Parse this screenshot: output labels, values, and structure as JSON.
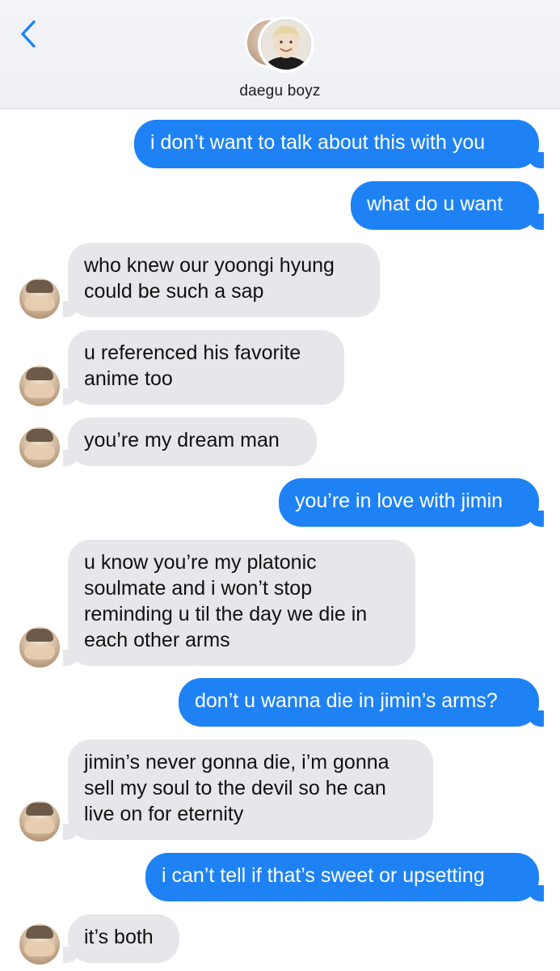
{
  "header": {
    "title": "daegu boyz",
    "back_icon": "chevron-left-icon",
    "accent": "#1e82f5"
  },
  "colors": {
    "sent_bubble": "#1e82f5",
    "received_bubble": "#e6e6eb",
    "sent_text": "#ffffff",
    "received_text": "#111111"
  },
  "messages": [
    {
      "direction": "sent",
      "text": "i don’t want to talk about this with you"
    },
    {
      "direction": "sent",
      "text": "what do u want"
    },
    {
      "direction": "received",
      "text": "who knew our yoongi hyung\ncould be such a sap"
    },
    {
      "direction": "received",
      "text": "u referenced his favorite\nanime too"
    },
    {
      "direction": "received",
      "text": "you’re my dream man"
    },
    {
      "direction": "sent",
      "text": "you’re in love with jimin"
    },
    {
      "direction": "received",
      "text": "u know you’re my platonic\nsoulmate and i won’t stop\nreminding u til the day we die in\neach other arms"
    },
    {
      "direction": "sent",
      "text": "don’t u wanna die in jimin’s arms?"
    },
    {
      "direction": "received",
      "text": "jimin’s never gonna die, i’m gonna\nsell my soul to the devil so he can\nlive on for eternity"
    },
    {
      "direction": "sent",
      "text": "i can’t tell if that’s sweet or upsetting"
    },
    {
      "direction": "received",
      "text": "it’s both"
    }
  ]
}
